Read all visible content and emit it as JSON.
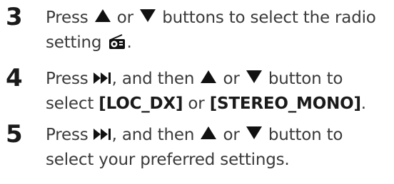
{
  "steps": [
    {
      "number": "3",
      "line1": {
        "before": "Press",
        "mid": "or",
        "after": "buttons to select the radio"
      },
      "line2": {
        "text": "setting",
        "icon": "radio-icon",
        "end": "."
      }
    },
    {
      "number": "4",
      "line1": {
        "before": "Press",
        "after_skip": ", and then",
        "mid": "or",
        "after": "button to"
      },
      "line2": {
        "before": "select",
        "bold1": "[LOC_DX]",
        "mid": "or",
        "bold2": "[STEREO_MONO]",
        "end": "."
      }
    },
    {
      "number": "5",
      "line1": {
        "before": "Press",
        "after_skip": ", and then",
        "mid": "or",
        "after": "button to"
      },
      "line2": {
        "text": "select your preferred settings."
      }
    }
  ],
  "icons": {
    "up": "triangle-up-icon",
    "down": "triangle-down-icon",
    "next": "skip-next-icon",
    "radio": "radio-icon"
  },
  "colors": {
    "text": "#3a3a3a",
    "number": "#1a1a1a",
    "icon": "#111111"
  }
}
